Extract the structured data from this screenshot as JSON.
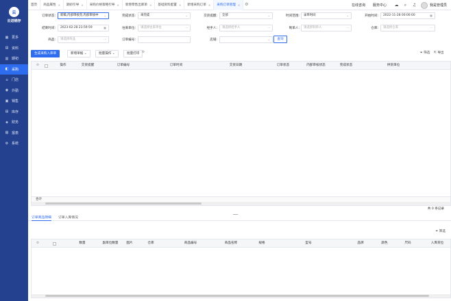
{
  "app": {
    "name": "云进销存",
    "logo_text": "云"
  },
  "sidebar": {
    "items": [
      {
        "label": "更多",
        "icon": "grid-icon"
      },
      {
        "label": "资料",
        "icon": "folder-icon"
      },
      {
        "label": "期初",
        "icon": "calendar-icon"
      },
      {
        "label": "采购",
        "icon": "cart-icon",
        "active": true
      },
      {
        "label": "门店",
        "icon": "store-icon"
      },
      {
        "label": "外勤",
        "icon": "location-icon"
      },
      {
        "label": "销售",
        "icon": "sales-icon"
      },
      {
        "label": "库存",
        "icon": "warehouse-icon"
      },
      {
        "label": "财务",
        "icon": "money-icon"
      },
      {
        "label": "报表",
        "icon": "report-icon"
      },
      {
        "label": "系统",
        "icon": "gear-icon"
      }
    ]
  },
  "tabs": [
    {
      "label": "首页"
    },
    {
      "label": "商品属性"
    },
    {
      "label": "期初引导"
    },
    {
      "label": "采购价格策略引导"
    },
    {
      "label": "新增零售出库单"
    },
    {
      "label": "基础资料配置"
    },
    {
      "label": "新增采购订单"
    },
    {
      "label": "采购订单管理",
      "active": true
    }
  ],
  "header": {
    "online_consult": "在线咨询",
    "service_center": "服务中心",
    "username": "我是管理员"
  },
  "filters": {
    "order_status_label": "订单状态:",
    "order_status_value": "新稿,内部审核完,内部审核中",
    "complete_status_label": "完成状态:",
    "complete_status_value": "未完成",
    "delivery_reminder_label": "交货提醒:",
    "delivery_reminder_value": "全部",
    "time_range_label": "时间范围:",
    "time_range_value": "录单时间",
    "start_time_label": "开始时间:",
    "start_time_value": "2022-11-28 00:00:00",
    "end_time_label": "结束时间:",
    "end_time_value": "2023-02-28 23:59:59",
    "supplier_label": "往来单位:",
    "supplier_placeholder": "请选择往来单位",
    "handler_label": "经手人:",
    "handler_placeholder": "请选择经手人",
    "creator_label": "制单人:",
    "creator_placeholder": "请选择制单人",
    "warehouse_label": "仓库:",
    "warehouse_placeholder": "请选择仓库",
    "product_label": "商品:",
    "product_placeholder": "请选择商品",
    "order_no_label": "订单编号:",
    "order_no_value": "",
    "shop_label": "店铺:",
    "shop_value": "",
    "query_button": "查询"
  },
  "toolbar": {
    "generate_button": "生成采购入库单",
    "new_button": "新增单据",
    "batch_button": "批量操作",
    "print_button": "批量打印",
    "filter_label": "筛选",
    "export_label": "导出"
  },
  "order_table": {
    "columns": [
      "操作",
      "交货提醒",
      "订单编号",
      "订单时间",
      "交货日期",
      "订单状态",
      "内部审核状态",
      "完成状态",
      "供货单位"
    ],
    "footer_label": "合计",
    "total_text": "共 0 条记录"
  },
  "bottom_tabs": [
    {
      "label": "订单商品明细",
      "active": true
    },
    {
      "label": "订单入库情况"
    }
  ],
  "detail_table": {
    "filter_label": "筛选",
    "columns": [
      "数量",
      "副单位数量",
      "图片",
      "仓库",
      "商品编号",
      "商品名称",
      "规格",
      "型号",
      "品牌",
      "颜色",
      "尺码",
      "入库货位"
    ]
  }
}
